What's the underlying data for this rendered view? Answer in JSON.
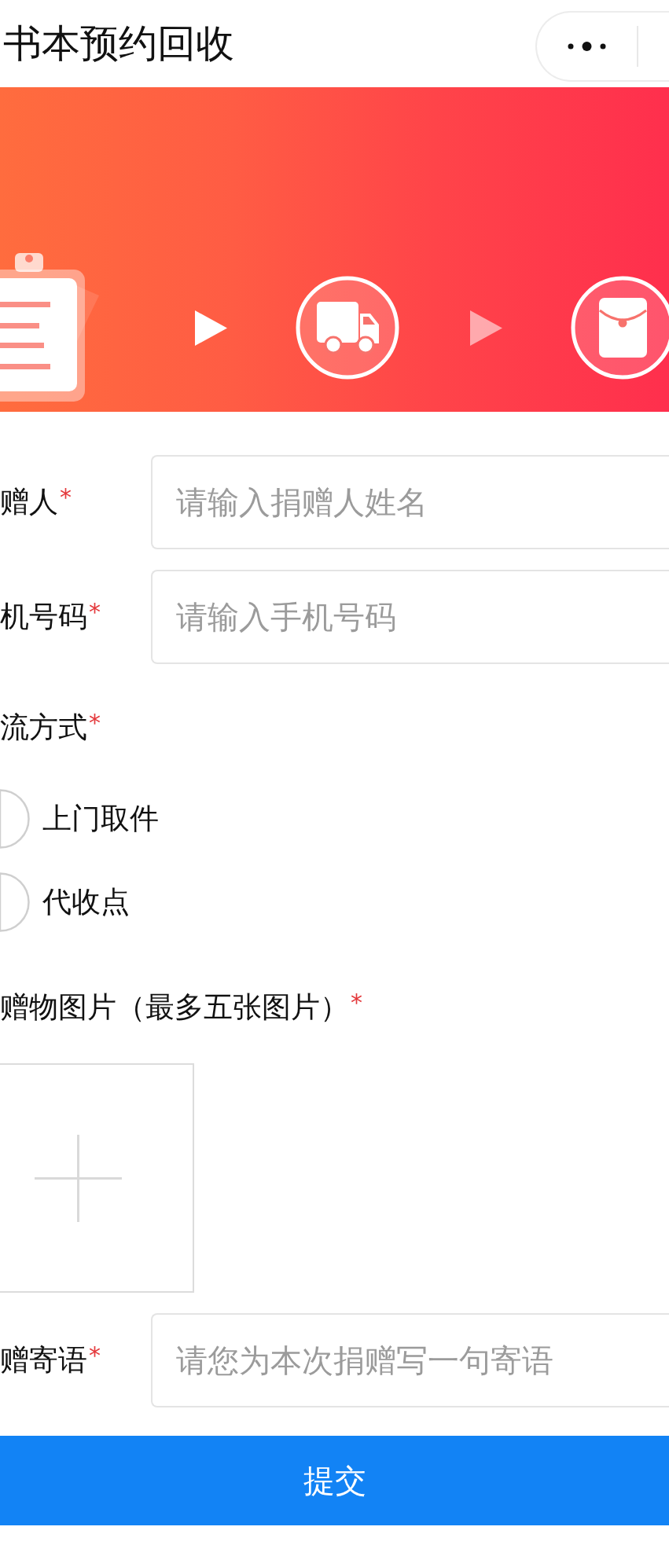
{
  "nav_bar": {
    "title": "书本预约回收"
  },
  "form": {
    "fields": [
      {
        "kind": "text",
        "label": "赠人",
        "required_mark": "*",
        "placeholder": "请输入捐赠人姓名"
      },
      {
        "kind": "text",
        "label": "机号码",
        "required_mark": "*",
        "placeholder": "请输入手机号码"
      },
      {
        "kind": "radio",
        "label": "流方式",
        "required_mark": "*",
        "options": [
          {
            "label": "上门取件",
            "selected": false
          },
          {
            "label": "代收点",
            "selected": false
          }
        ]
      },
      {
        "kind": "upload",
        "label": "赠物图片（最多五张图片）",
        "required_mark": "*"
      },
      {
        "kind": "text",
        "label": "赠寄语",
        "required_mark": "*",
        "placeholder": "请您为本次捐赠写一句寄语"
      }
    ]
  },
  "submit_button": {
    "label": "提交"
  }
}
